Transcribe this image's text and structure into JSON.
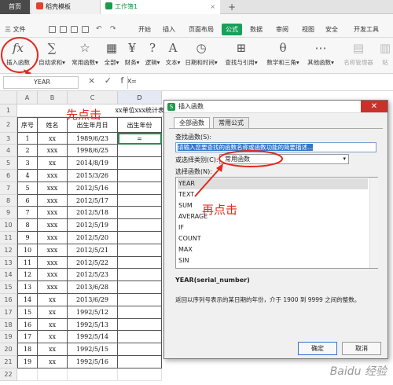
{
  "tabs": {
    "home": "首页",
    "template": "稻壳模板",
    "workbook": "工作簿1",
    "close": "×",
    "new_tab": "+"
  },
  "menu": {
    "file": "三 文件",
    "items": [
      "开始",
      "插入",
      "页面布局",
      "公式",
      "数据",
      "审阅",
      "视图",
      "安全",
      "开发工具"
    ],
    "active": "公式"
  },
  "ribbon": [
    {
      "glyph": "fx",
      "label": "插入函数"
    },
    {
      "glyph": "∑",
      "label": "自动求和▾"
    },
    {
      "glyph": "☆",
      "label": "常用函数▾"
    },
    {
      "glyph": "▦",
      "label": "全部▾"
    },
    {
      "glyph": "¥",
      "label": "财务▾"
    },
    {
      "glyph": "?",
      "label": "逻辑▾"
    },
    {
      "glyph": "A",
      "label": "文本▾"
    },
    {
      "glyph": "◷",
      "label": "日期和时间▾"
    },
    {
      "glyph": "⊞",
      "label": "查找与引用▾"
    },
    {
      "glyph": "θ",
      "label": "数学和三角▾"
    },
    {
      "glyph": "⋯",
      "label": "其他函数▾"
    },
    {
      "glyph": "▤",
      "label": "名称管理器"
    },
    {
      "glyph": "▥",
      "label": "粘"
    }
  ],
  "formula_bar": {
    "name_box": "YEAR",
    "symbols": "× ✓ fx",
    "input": "="
  },
  "columns": [
    "A",
    "B",
    "C",
    "D"
  ],
  "sheet_title": "xx单位xxx统计表",
  "headers": [
    "序号",
    "姓名",
    "出生年月日",
    "出生年份"
  ],
  "rows": [
    [
      "1",
      "xx",
      "1989/6/23",
      "="
    ],
    [
      "2",
      "xxx",
      "1998/6/25",
      ""
    ],
    [
      "3",
      "xx",
      "2014/8/19",
      ""
    ],
    [
      "4",
      "xxx",
      "2015/3/26",
      ""
    ],
    [
      "5",
      "xxx",
      "2012/5/16",
      ""
    ],
    [
      "6",
      "xxx",
      "2012/5/17",
      ""
    ],
    [
      "7",
      "xxx",
      "2012/5/18",
      ""
    ],
    [
      "8",
      "xxx",
      "2012/5/19",
      ""
    ],
    [
      "9",
      "xxx",
      "2012/5/20",
      ""
    ],
    [
      "10",
      "xxx",
      "2012/5/21",
      ""
    ],
    [
      "11",
      "xxx",
      "2012/5/22",
      ""
    ],
    [
      "12",
      "xxx",
      "2012/5/23",
      ""
    ],
    [
      "13",
      "xxx",
      "2013/6/28",
      ""
    ],
    [
      "14",
      "xx",
      "2013/6/29",
      ""
    ],
    [
      "15",
      "xx",
      "1992/5/12",
      ""
    ],
    [
      "16",
      "xx",
      "1992/5/13",
      ""
    ],
    [
      "17",
      "xx",
      "1992/5/14",
      ""
    ],
    [
      "18",
      "xx",
      "1992/5/15",
      ""
    ],
    [
      "19",
      "xx",
      "1992/5/16",
      ""
    ]
  ],
  "row_numbers": [
    "1",
    "2",
    "3",
    "4",
    "5",
    "6",
    "7",
    "8",
    "9",
    "10",
    "11",
    "12",
    "13",
    "14",
    "15",
    "16",
    "17",
    "18",
    "19",
    "20",
    "21",
    "22"
  ],
  "dialog": {
    "icon": "S",
    "title": "插入函数",
    "close": "✕",
    "tabs": [
      "全部函数",
      "常用公式"
    ],
    "search_label": "查找函数(S):",
    "search_placeholder": "请输入您要查找的函数名称或函数功能的简要描述...",
    "category_label": "或选择类别(C):",
    "category_value": "常用函数",
    "category_arrow": "▾",
    "list_label": "选择函数(N):",
    "functions": [
      "YEAR",
      "TEXT",
      "SUM",
      "AVERAGE",
      "IF",
      "COUNT",
      "MAX",
      "SIN"
    ],
    "signature": "YEAR(serial_number)",
    "description": "返回以序列号表示的某日期的年份，介于 1900 到 9999 之间的整数。",
    "ok": "确定",
    "cancel": "取消"
  },
  "annotations": {
    "first": "先点击",
    "second": "再点击"
  },
  "watermark": "Baidu 经验",
  "colors": {
    "accent": "#19a05a",
    "annotation": "#e02a20",
    "selection": "#3478c8"
  }
}
